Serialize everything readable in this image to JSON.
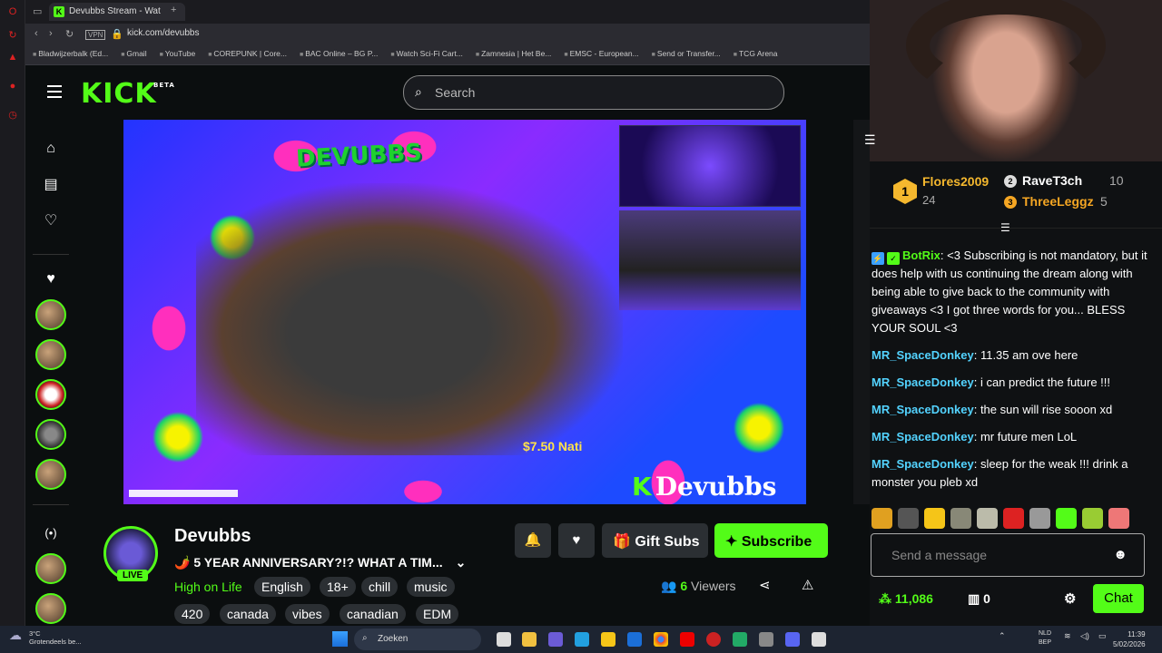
{
  "browser": {
    "tab_title": "Devubbs Stream - Wat",
    "url": "kick.com/devubbs",
    "bookmarks": [
      "Bladwijzerbalk (Ed...",
      "Gmail",
      "YouTube",
      "COREPUNK | Core...",
      "BAC Online – BG P...",
      "Watch Sci-Fi Cart...",
      "Zamnesia | Het Be...",
      "EMSC - European...",
      "Send or Transfer...",
      "TCG Arena"
    ],
    "vpn_label": "VPN"
  },
  "header": {
    "logo": "KICK",
    "logo_badge": "BETA",
    "search_placeholder": "Search"
  },
  "video": {
    "watermark": "DEVUBBS",
    "brand": "Devubbs",
    "donation_text": "$7.50 Nati"
  },
  "channel": {
    "name": "Devubbs",
    "live_label": "LIVE",
    "title": "🌶️ 5 YEAR ANNIVERSARY?!? WHAT A TIM...",
    "category": "High on Life",
    "tags": [
      "English",
      "18+",
      "chill",
      "music",
      "420",
      "canada",
      "vibes",
      "canadian",
      "EDM"
    ],
    "gift_label": "Gift Subs",
    "subscribe_label": "Subscribe",
    "viewer_count": "6",
    "viewers_label": "Viewers"
  },
  "leaderboard": {
    "first": {
      "rank": "1",
      "name": "Flores2009",
      "count": "24"
    },
    "second": {
      "rank": "2",
      "name": "RaveT3ch",
      "count": "10"
    },
    "third": {
      "rank": "3",
      "name": "ThreeLeggz",
      "count": "5"
    }
  },
  "chat": {
    "messages": [
      {
        "user": "BotRix",
        "text": ": <3 Subscribing is not mandatory, but it does help with us continuing the dream along with being able to give back to the community with giveaways <3 I got three words for you... BLESS YOUR SOUL <3"
      },
      {
        "user": "MR_SpaceDonkey",
        "text": ": 11.35 am ove here"
      },
      {
        "user": "MR_SpaceDonkey",
        "text": ": i can predict the future !!!"
      },
      {
        "user": "MR_SpaceDonkey",
        "text": ": the sun will rise sooon xd"
      },
      {
        "user": "MR_SpaceDonkey",
        "text": ": mr future men LoL"
      },
      {
        "user": "MR_SpaceDonkey",
        "text": ": sleep for the weak !!! drink a monster you pleb xd"
      }
    ],
    "input_placeholder": "Send a message",
    "points": "11,086",
    "redemptions": "0",
    "chat_button": "Chat"
  },
  "taskbar": {
    "weather_temp": "3°C",
    "weather_desc": "Grotendeels be...",
    "search_label": "Zoeken",
    "lang": "NLD",
    "lang2": "BEP",
    "time": "11:39",
    "date": "5/02/2026"
  }
}
